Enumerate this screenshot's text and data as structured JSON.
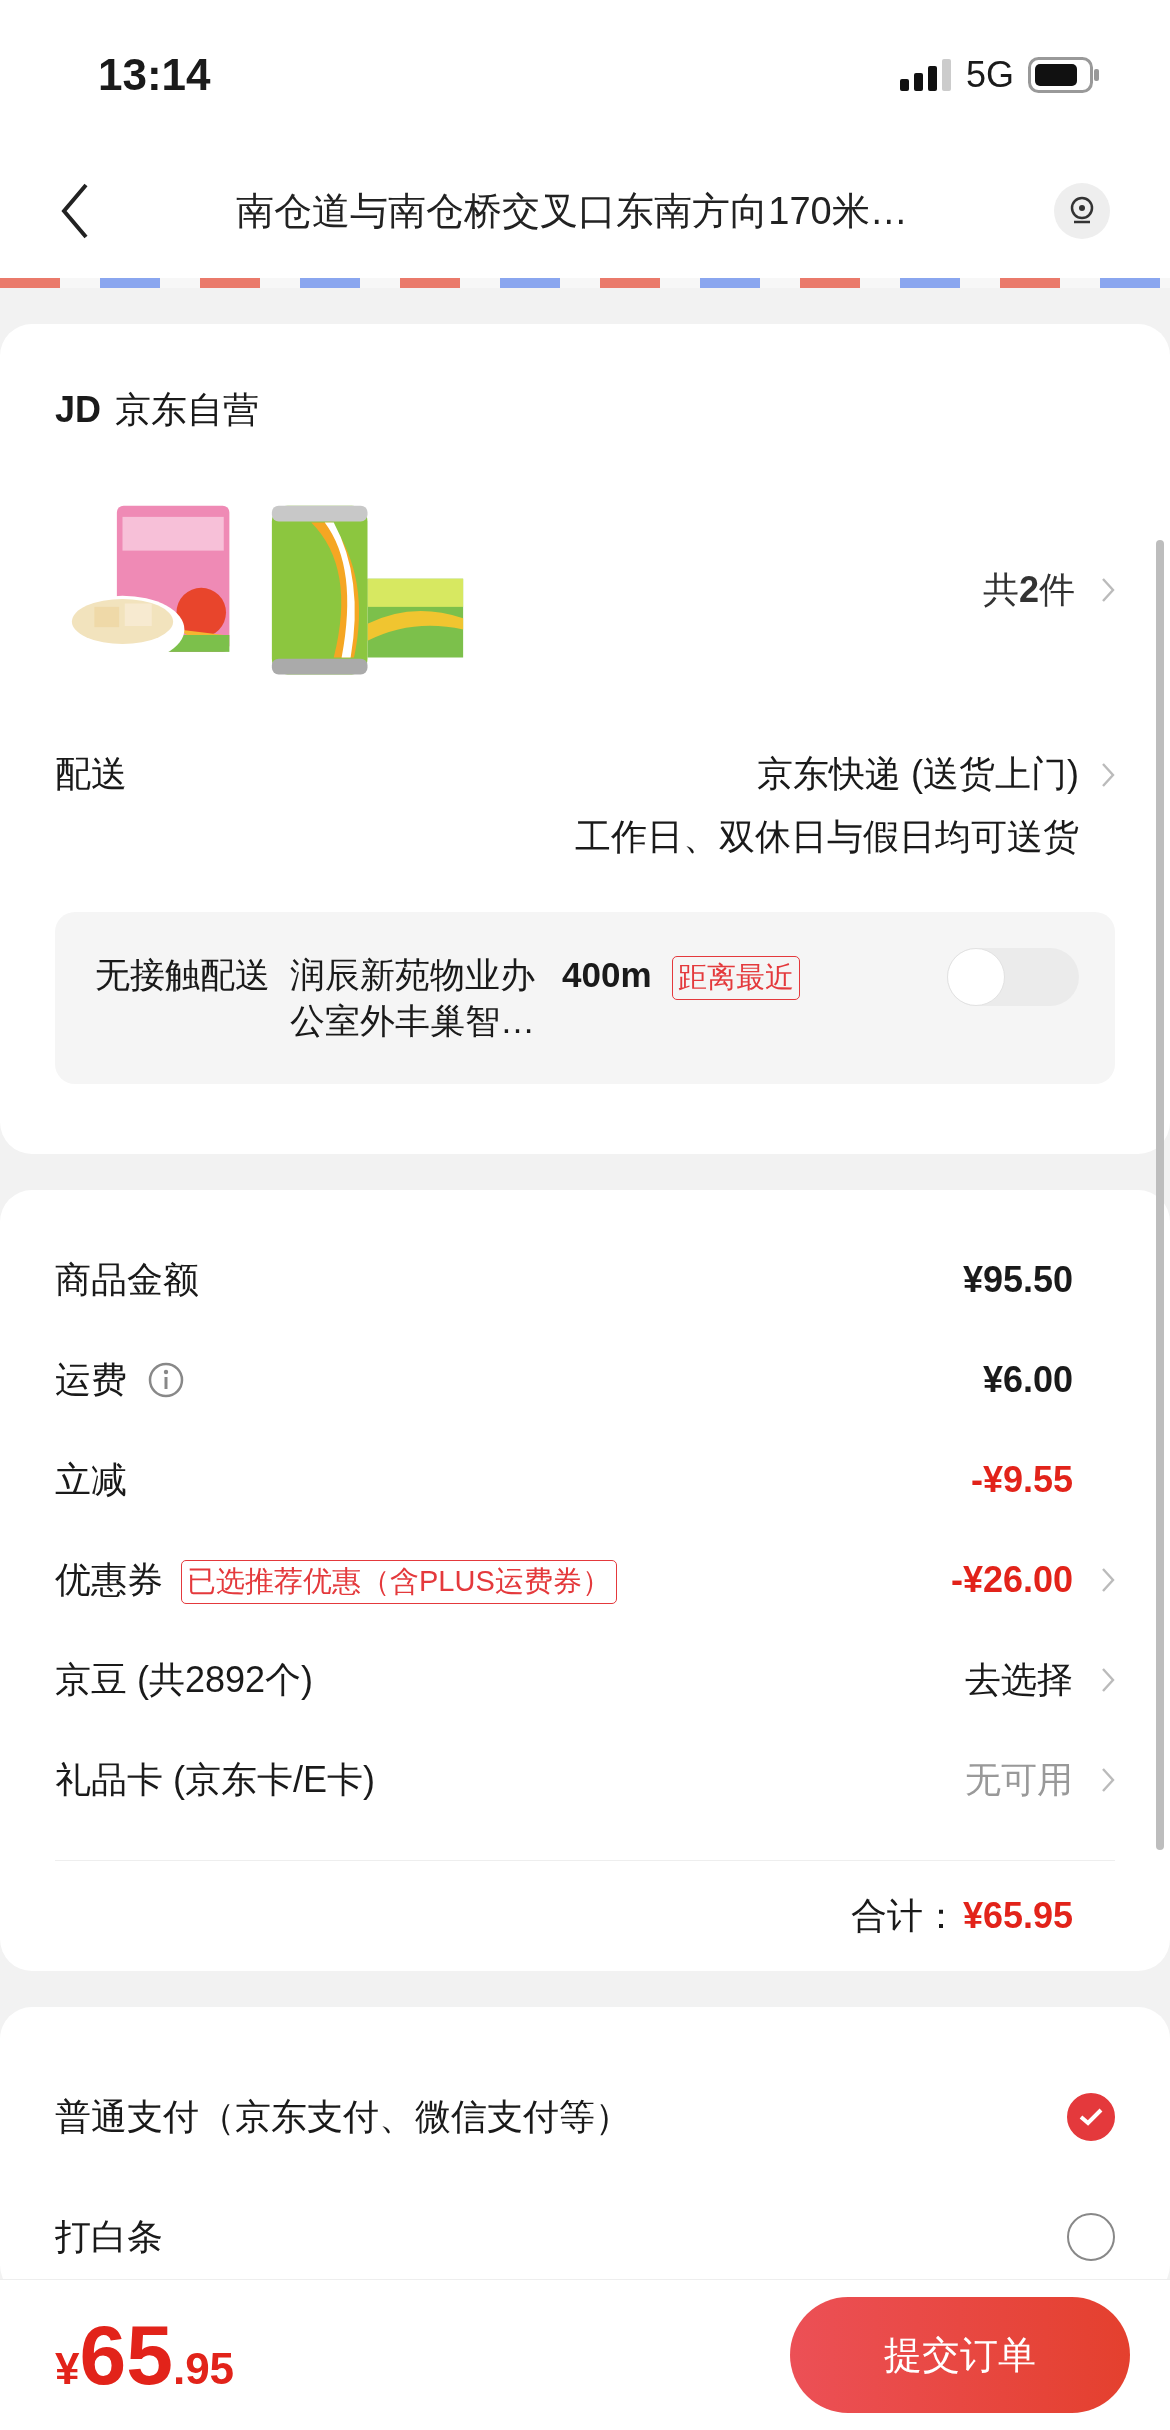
{
  "status_bar": {
    "time": "13:14",
    "network": "5G"
  },
  "nav": {
    "title": "南仓道与南仓桥交叉口东南方向170米…"
  },
  "shop": {
    "logo": "JD",
    "name": "京东自营",
    "count": "共**2**件"
  },
  "delivery": {
    "label": "配送",
    "method": "京东快递 (送货上门)",
    "schedule": "工作日、双休日与假日均可送货"
  },
  "contactless": {
    "label": "无接触配送",
    "location": "润辰新苑物业办公室外丰巢智…",
    "distance": "400m",
    "tag": "距离最近",
    "on": false
  },
  "price_rows": [
    {
      "kind": "amount",
      "label": "商品金额",
      "value": "¥95.50",
      "color": "#1a1a1a",
      "info": false,
      "chevron": false
    },
    {
      "kind": "amount",
      "label": "运费",
      "value": "¥6.00",
      "color": "#1a1a1a",
      "info": true,
      "chevron": false
    },
    {
      "kind": "amount",
      "label": "立减",
      "value": "-¥9.55",
      "color": "#e2231a",
      "info": false,
      "chevron": false
    },
    {
      "kind": "amount",
      "label": "优惠券",
      "tag": "已选推荐优惠（含PLUS运费券）",
      "value": "-¥26.00",
      "color": "#e2231a",
      "info": false,
      "chevron": true
    },
    {
      "kind": "action",
      "label": "京豆 (共2892个)",
      "value": "去选择",
      "color": "#1a1a1a",
      "info": false,
      "chevron": true
    },
    {
      "kind": "action",
      "label": "礼品卡 (京东卡/E卡)",
      "value": "无可用",
      "color": "#999999",
      "info": false,
      "chevron": true
    }
  ],
  "total": {
    "label": "合计：",
    "value": "¥65.95"
  },
  "payments": [
    {
      "label": "普通支付（京东支付、微信支付等）",
      "selected": true
    },
    {
      "label": "打白条",
      "selected": false
    }
  ],
  "footer": {
    "currency": "¥",
    "integer": "65",
    "decimal": ".95",
    "submit": "提交订单"
  }
}
